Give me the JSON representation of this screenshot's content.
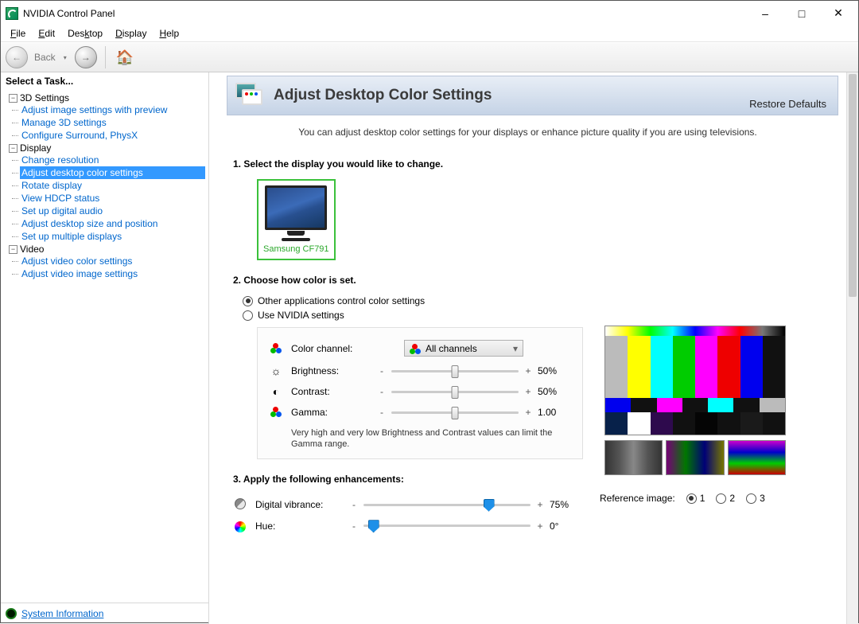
{
  "app": {
    "title": "NVIDIA Control Panel"
  },
  "menu": {
    "file": "File",
    "edit": "Edit",
    "desktop": "Desktop",
    "display": "Display",
    "help": "Help"
  },
  "toolbar": {
    "back": "Back"
  },
  "sidebar": {
    "header": "Select a Task...",
    "groups": [
      {
        "label": "3D Settings",
        "items": [
          "Adjust image settings with preview",
          "Manage 3D settings",
          "Configure Surround, PhysX"
        ]
      },
      {
        "label": "Display",
        "items": [
          "Change resolution",
          "Adjust desktop color settings",
          "Rotate display",
          "View HDCP status",
          "Set up digital audio",
          "Adjust desktop size and position",
          "Set up multiple displays"
        ],
        "selected": 1
      },
      {
        "label": "Video",
        "items": [
          "Adjust video color settings",
          "Adjust video image settings"
        ]
      }
    ],
    "sysinfo": "System Information"
  },
  "main": {
    "title": "Adjust Desktop Color Settings",
    "restore": "Restore Defaults",
    "desc": "You can adjust desktop color settings for your displays or enhance picture quality if you are using televisions.",
    "step1": "1. Select the display you would like to change.",
    "display_name": "Samsung CF791",
    "step2": "2. Choose how color is set.",
    "radio_other": "Other applications control color settings",
    "radio_nvidia": "Use NVIDIA settings",
    "color_channel_label": "Color channel:",
    "color_channel_value": "All channels",
    "brightness": {
      "label": "Brightness:",
      "value": "50%",
      "pos": 50
    },
    "contrast": {
      "label": "Contrast:",
      "value": "50%",
      "pos": 50
    },
    "gamma": {
      "label": "Gamma:",
      "value": "1.00",
      "pos": 50
    },
    "note": "Very high and very low Brightness and Contrast values can limit the Gamma range.",
    "step3": "3. Apply the following enhancements:",
    "dv": {
      "label": "Digital vibrance:",
      "value": "75%",
      "pos": 75
    },
    "hue": {
      "label": "Hue:",
      "value": "0°",
      "pos": 6
    },
    "ref_label": "Reference image:",
    "ref_opts": [
      "1",
      "2",
      "3"
    ],
    "ref_selected": 0
  }
}
